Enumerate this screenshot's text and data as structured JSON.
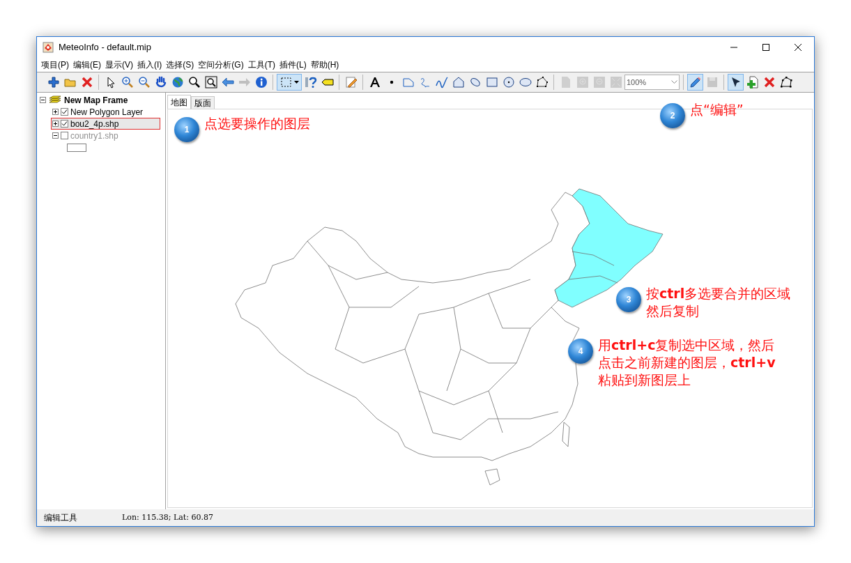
{
  "window": {
    "title": "MeteoInfo - default.mip"
  },
  "menu": [
    "项目(P)",
    "编辑(E)",
    "显示(V)",
    "插入(I)",
    "选择(S)",
    "空间分析(G)",
    "工具(T)",
    "插件(L)",
    "帮助(H)"
  ],
  "toolbar": [
    {
      "kind": "button",
      "selected": false,
      "disabled": false
    },
    {
      "kind": "button",
      "selected": false,
      "disabled": false
    },
    {
      "kind": "button",
      "selected": false,
      "disabled": false
    },
    {
      "kind": "separator"
    },
    {
      "kind": "button",
      "selected": false,
      "disabled": false
    },
    {
      "kind": "button",
      "selected": false,
      "disabled": false
    },
    {
      "kind": "button",
      "selected": false,
      "disabled": false
    },
    {
      "kind": "button",
      "selected": false,
      "disabled": false
    },
    {
      "kind": "button",
      "selected": false,
      "disabled": false
    },
    {
      "kind": "button",
      "selected": false,
      "disabled": false
    },
    {
      "kind": "button",
      "selected": false,
      "disabled": false
    },
    {
      "kind": "button",
      "selected": false,
      "disabled": false
    },
    {
      "kind": "button",
      "selected": false,
      "disabled": true
    },
    {
      "kind": "button",
      "selected": false,
      "disabled": false
    },
    {
      "kind": "separator"
    },
    {
      "kind": "dropdown",
      "selected": true,
      "disabled": false
    },
    {
      "kind": "button",
      "selected": false,
      "disabled": false
    },
    {
      "kind": "button",
      "selected": false,
      "disabled": false
    },
    {
      "kind": "separator"
    },
    {
      "kind": "button",
      "selected": false,
      "disabled": false
    },
    {
      "kind": "separator"
    },
    {
      "kind": "button",
      "selected": false,
      "disabled": false
    },
    {
      "kind": "button",
      "selected": false,
      "disabled": false
    },
    {
      "kind": "button",
      "selected": false,
      "disabled": false
    },
    {
      "kind": "button",
      "selected": false,
      "disabled": false
    },
    {
      "kind": "button",
      "selected": false,
      "disabled": false
    },
    {
      "kind": "button",
      "selected": false,
      "disabled": false
    },
    {
      "kind": "button",
      "selected": false,
      "disabled": false
    },
    {
      "kind": "button",
      "selected": false,
      "disabled": false
    },
    {
      "kind": "button",
      "selected": false,
      "disabled": false
    },
    {
      "kind": "button",
      "selected": false,
      "disabled": false
    },
    {
      "kind": "button",
      "selected": false,
      "disabled": false
    },
    {
      "kind": "separator"
    },
    {
      "kind": "button",
      "selected": false,
      "disabled": true
    },
    {
      "kind": "button",
      "selected": false,
      "disabled": true
    },
    {
      "kind": "button",
      "selected": false,
      "disabled": true
    },
    {
      "kind": "button",
      "selected": false,
      "disabled": true
    },
    {
      "kind": "combo",
      "value": "100%"
    },
    {
      "kind": "separator"
    },
    {
      "kind": "button",
      "selected": true,
      "disabled": false
    },
    {
      "kind": "button",
      "selected": false,
      "disabled": true
    },
    {
      "kind": "separator"
    },
    {
      "kind": "button",
      "selected": true,
      "disabled": false
    },
    {
      "kind": "button",
      "selected": false,
      "disabled": false
    },
    {
      "kind": "button",
      "selected": false,
      "disabled": false
    },
    {
      "kind": "button",
      "selected": false,
      "disabled": false
    }
  ],
  "layers": {
    "label": "New Map Frame",
    "expanded": true,
    "children": [
      {
        "label": "New Polygon Layer",
        "expanded": false,
        "checked": true,
        "selected": false
      },
      {
        "label": "bou2_4p.shp",
        "expanded": false,
        "checked": true,
        "selected": true
      },
      {
        "label": "country1.shp",
        "expanded": true,
        "checked": false,
        "selected": false
      }
    ]
  },
  "tabs": [
    {
      "label": "地图",
      "selected": true
    },
    {
      "label": "版面",
      "selected": false
    }
  ],
  "notes": [
    {
      "number": "1",
      "text": "点选要操作的图层"
    },
    {
      "number": "2",
      "text": "点“编辑”"
    },
    {
      "number": "3",
      "text": "按**ctrl**多选要合并的区域然后复制"
    },
    {
      "number": "4",
      "text": "用**ctrl+c**复制选中区域，然后点击之前新建的图层，**ctrl+v**粘贴到新图层上"
    }
  ],
  "status_bar": {
    "tool": "编辑工具",
    "coordinates": "Lon: 115.38; Lat: 60.87"
  }
}
